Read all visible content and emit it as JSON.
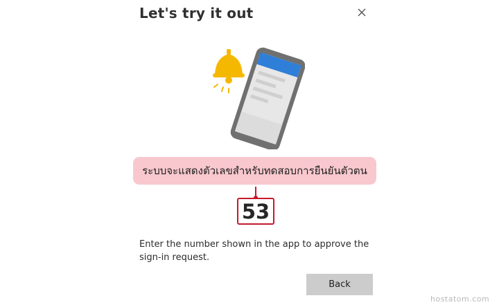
{
  "dialog": {
    "title": "Let's try it out",
    "close_icon": "close-icon",
    "illustration": {
      "bell_color": "#f5b800",
      "phone_frame_color": "#707070",
      "phone_header_color": "#2f7fd8"
    },
    "callout_text": "ระบบจะแสดงตัวเลขสำหรับทดสอบการยืนยันตัวตน",
    "callout_color": "#f8c8ce",
    "number": "53",
    "number_border_color": "#c6182c",
    "instruction": "Enter the number shown in the app to approve the sign-in request.",
    "back_label": "Back"
  },
  "watermark": "hostatom.com"
}
